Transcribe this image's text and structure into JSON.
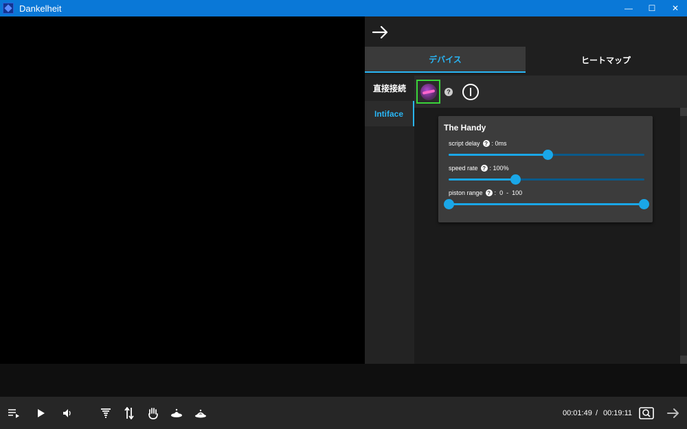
{
  "window": {
    "title": "Dankelheit",
    "minimize": "—",
    "maximize": "☐",
    "close": "✕"
  },
  "panel": {
    "tabs": [
      {
        "label": "デバイス",
        "active": true
      },
      {
        "label": "ヒートマップ",
        "active": false
      }
    ],
    "sidebar": [
      {
        "label": "直接接続",
        "active": false
      },
      {
        "label": "Intiface",
        "active": true
      }
    ],
    "device_help": "?",
    "card": {
      "title": "The Handy",
      "settings": [
        {
          "label": "script delay",
          "value_text": "0ms",
          "fraction": 0.505
        },
        {
          "label": "speed rate",
          "value_text": "100%",
          "fraction": 0.34
        },
        {
          "label": "piston range",
          "value_text": "0  -  100",
          "range": [
            0,
            100
          ]
        }
      ]
    }
  },
  "player": {
    "current_time": "00:01:49",
    "separator": "/",
    "total_time": "00:19:11"
  },
  "colors": {
    "accent": "#29b6f6",
    "titlebar": "#0a78d7",
    "device_border": "#3ad43a"
  }
}
